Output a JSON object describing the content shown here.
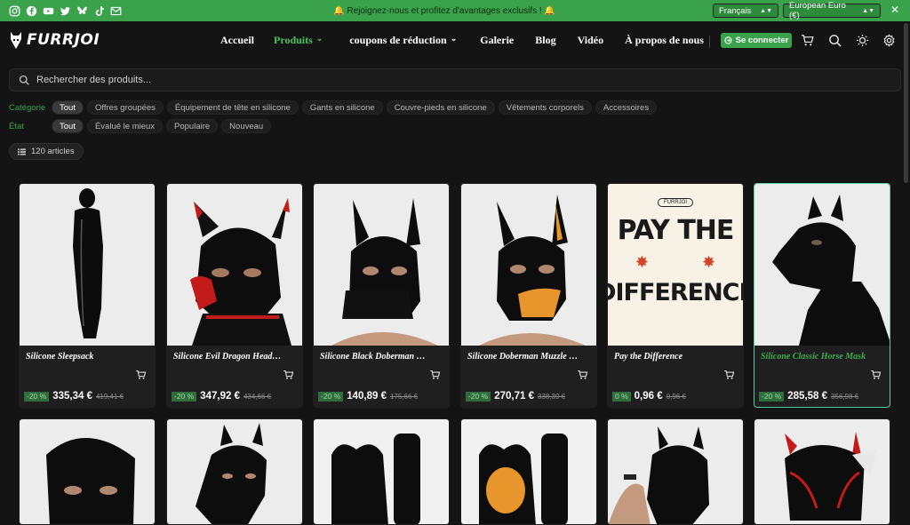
{
  "topbar": {
    "promo_text": "🔔 Rejoignez-nous et profitez d'avantages exclusifs ! 🔔",
    "language": "Français",
    "currency": "European Euro (€)",
    "close": "✕",
    "social_icons": [
      "instagram-icon",
      "facebook-icon",
      "youtube-icon",
      "twitter-icon",
      "bluesky-icon",
      "tiktok-icon",
      "mail-icon"
    ]
  },
  "nav": {
    "logo_text": "FURRJOI",
    "items": [
      "Accueil",
      "Produits",
      "coupons de réduction",
      "Galerie",
      "Blog",
      "Vidéo",
      "À propos de nous"
    ],
    "connect_label": "Se connecter",
    "icons": [
      "cart-icon",
      "search-icon",
      "theme-toggle-icon",
      "settings-icon"
    ]
  },
  "search": {
    "placeholder": "Rechercher des produits..."
  },
  "filters": {
    "category_label": "Catégorie",
    "categories": [
      "Tout",
      "Offres groupées",
      "Équipement de tête en silicone",
      "Gants en silicone",
      "Couvre-pieds en silicone",
      "Vêtements corporels",
      "Accessoires"
    ],
    "state_label": "État",
    "states": [
      "Tout",
      "Évalué le mieux",
      "Populaire",
      "Nouveau"
    ]
  },
  "count_label": "120 articles",
  "products": [
    {
      "title": "Silicone Sleepsack",
      "discount": "-20 %",
      "price": "335,34 €",
      "old_price": "419,41 €"
    },
    {
      "title": "Silicone Evil Dragon Headgear",
      "discount": "-20 %",
      "price": "347,92 €",
      "old_price": "434,66 €"
    },
    {
      "title": "Silicone Black Doberman Muzzle...",
      "discount": "-20 %",
      "price": "140,89 €",
      "old_price": "175,66 €"
    },
    {
      "title": "Silicone Doberman Muzzle Dog ...",
      "discount": "-20 %",
      "price": "270,71 €",
      "old_price": "338,39 €"
    },
    {
      "title": "Pay the Difference",
      "discount": "0 %",
      "price": "0,96 €",
      "old_price": "0,96 €",
      "poster_badge": "FURRJOI",
      "poster_line1": "PAY THE",
      "poster_line2": "DIFFERENCE"
    },
    {
      "title": "Silicone Classic Horse Mask",
      "discount": "-20 %",
      "price": "285,58 €",
      "old_price": "356,98 €"
    }
  ]
}
